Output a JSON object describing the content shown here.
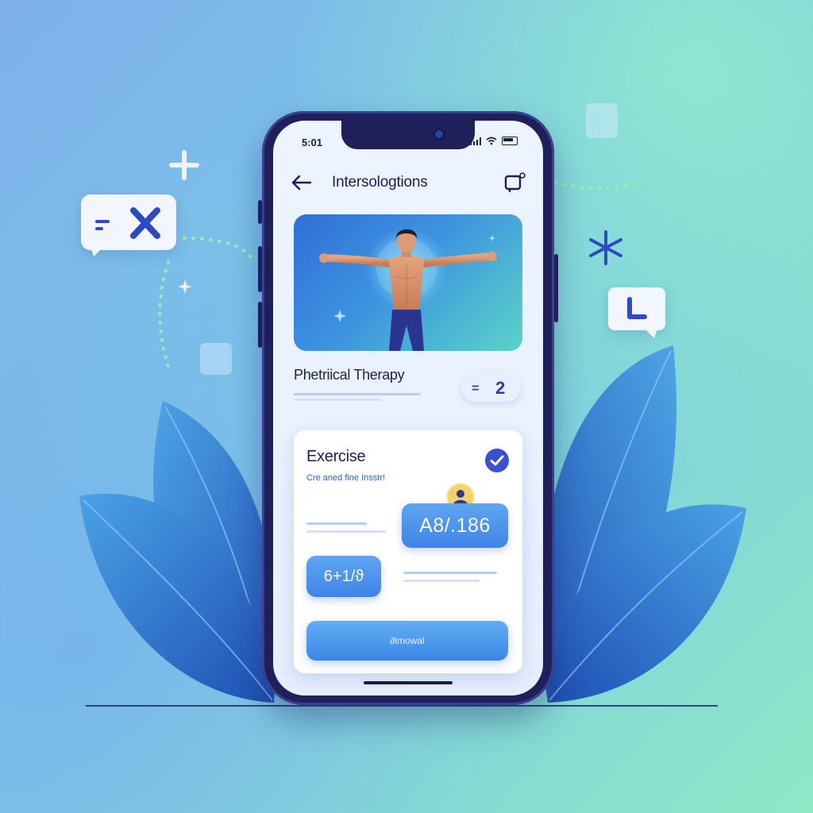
{
  "status_bar": {
    "time": "5:01"
  },
  "header": {
    "title": "Intersologtions",
    "back_icon": "arrow-left-icon",
    "action_icon": "square-notification-icon"
  },
  "hero": {
    "icon": "person-stretching-illustration"
  },
  "section": {
    "title": "Phetriical Therapy",
    "counter_symbol": "=",
    "counter_value": "2"
  },
  "exercise_card": {
    "title": "Exercise",
    "subtitle": "Cre aned fine Insstr!",
    "value_primary": "A8/.186",
    "value_secondary": "6+1/ϑ",
    "button_label": "∂imowal",
    "check_icon": "check-circle-icon",
    "avatar_icon": "user-avatar-icon"
  },
  "decorations": {
    "bubble_left_symbol": "=X",
    "bubble_right_symbol": "L",
    "plus_icon": "plus-icon",
    "asterisk_icon": "asterisk-icon",
    "sparkle_icon": "sparkle-icon"
  },
  "colors": {
    "accent": "#3f84e6",
    "dark": "#1f1f5a",
    "leaf": "#2a6fc6",
    "indigo": "#2c3ab8"
  }
}
